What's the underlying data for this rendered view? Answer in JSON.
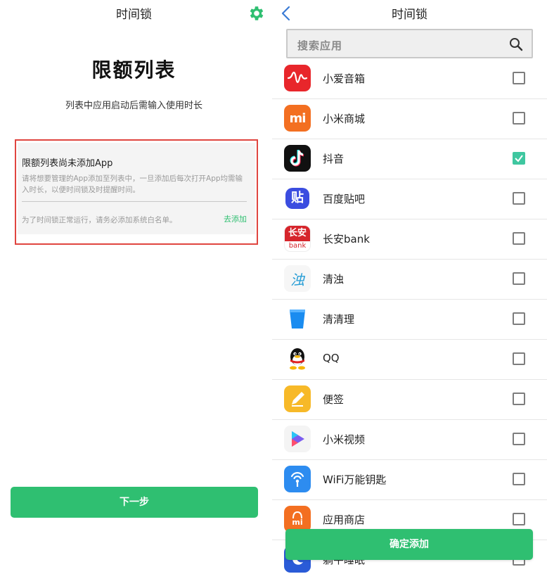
{
  "left": {
    "title": "时间锁",
    "heading": "限额列表",
    "subtitle": "列表中应用启动后需输入使用时长",
    "card": {
      "head": "限额列表尚未添加App",
      "desc": "请将想要管理的App添加至列表中，一旦添加后每次打开App均需输入时长，以便时间锁及时提醒时间。",
      "foot": "为了时间锁正常运行，请务必添加系统白名单。",
      "link": "去添加"
    },
    "next_label": "下一步"
  },
  "right": {
    "title": "时间锁",
    "search_placeholder": "搜索应用",
    "apps": [
      {
        "name": "小爱音箱",
        "icon": "xiaoai-speaker-icon",
        "checked": false
      },
      {
        "name": "小米商城",
        "icon": "mi-store-icon",
        "checked": false
      },
      {
        "name": "抖音",
        "icon": "douyin-icon",
        "checked": true
      },
      {
        "name": "百度贴吧",
        "icon": "baidu-tieba-icon",
        "checked": false
      },
      {
        "name": "长安bank",
        "icon": "changan-bank-icon",
        "checked": false
      },
      {
        "name": "清浊",
        "icon": "qingzhuo-icon",
        "checked": false
      },
      {
        "name": "清清理",
        "icon": "cleaner-bucket-icon",
        "checked": false
      },
      {
        "name": "QQ",
        "icon": "qq-penguin-icon",
        "checked": false
      },
      {
        "name": "便签",
        "icon": "notes-pencil-icon",
        "checked": false
      },
      {
        "name": "小米视频",
        "icon": "mi-video-icon",
        "checked": false
      },
      {
        "name": "WiFi万能钥匙",
        "icon": "wifi-key-icon",
        "checked": false
      },
      {
        "name": "应用商店",
        "icon": "app-store-bag-icon",
        "checked": false
      },
      {
        "name": "躺平睡眠",
        "icon": "sleep-icon",
        "checked": false
      }
    ],
    "icon_texts": {
      "mi": "mi",
      "tieba": "贴",
      "changan_top": "长安",
      "changan_bottom": "bank",
      "qingzhuo": "浊",
      "store_mi": "mi"
    },
    "confirm_label": "确定添加"
  },
  "colors": {
    "accent_green": "#2fbf71",
    "highlight_red": "#e0453f",
    "checkbox_checked": "#3fc7a0"
  }
}
